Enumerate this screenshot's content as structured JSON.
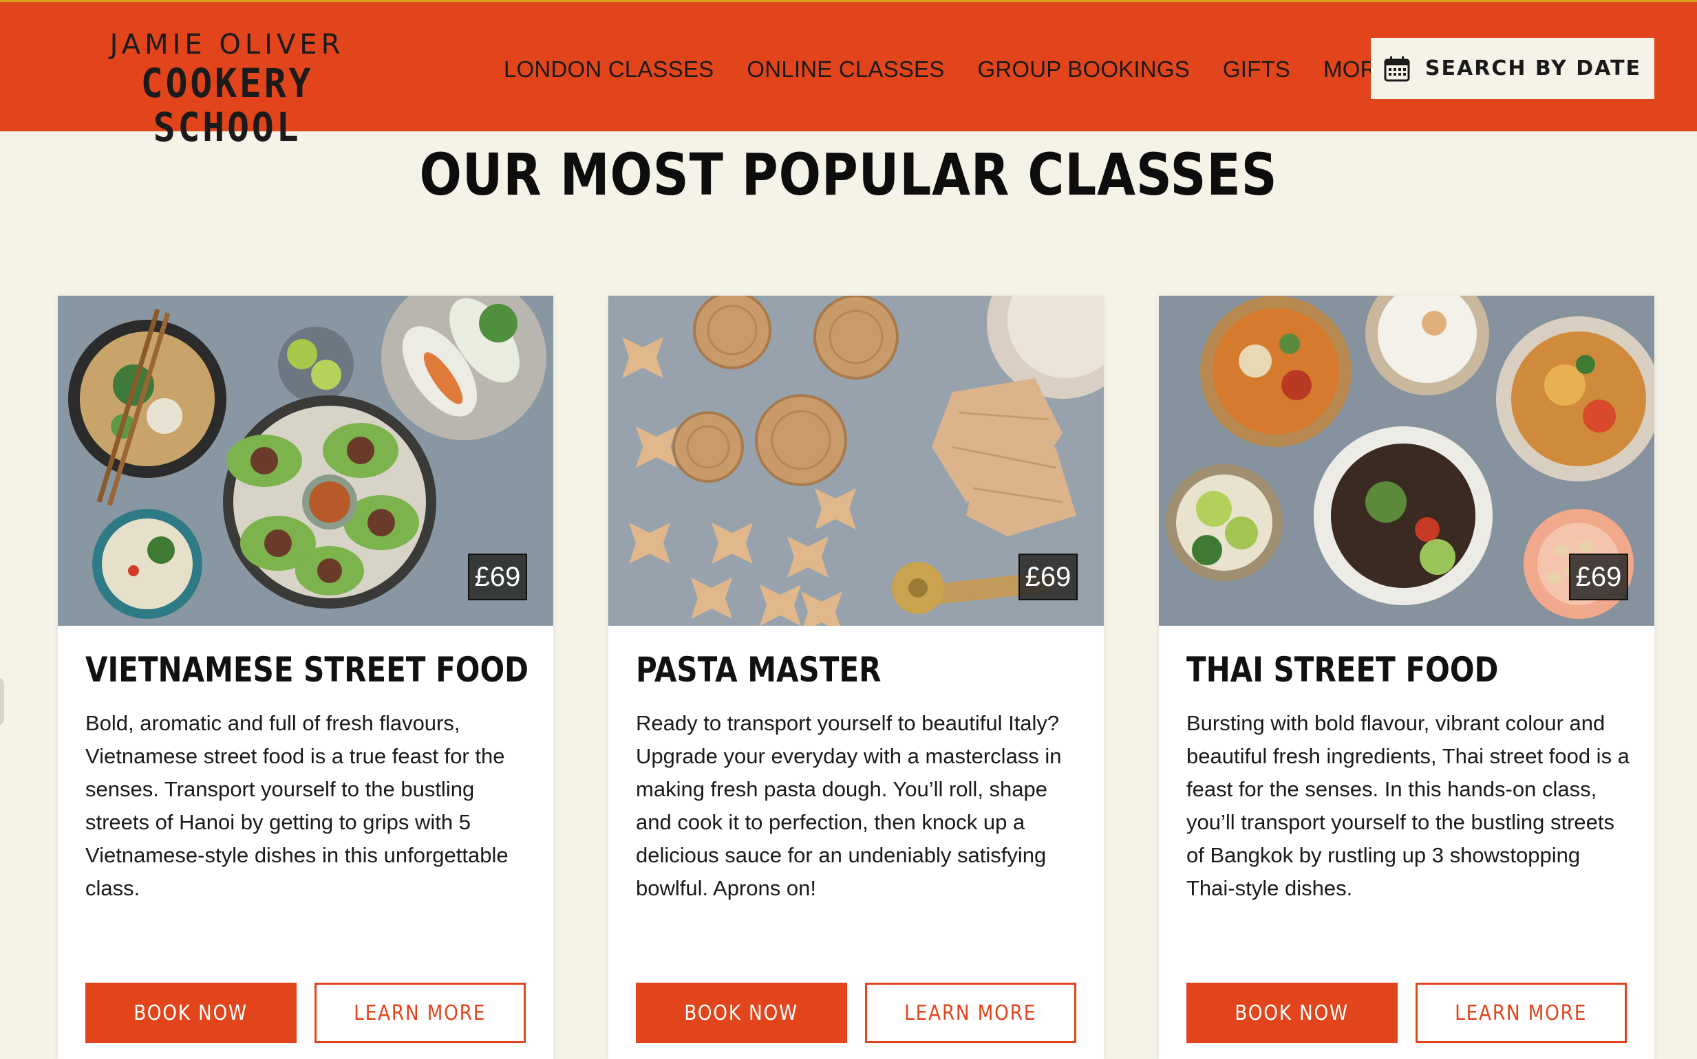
{
  "brand": {
    "line1": "JAMIE OLIVER",
    "line2": "COOKERY SCHOOL"
  },
  "nav": {
    "items": [
      "LONDON CLASSES",
      "ONLINE CLASSES",
      "GROUP BOOKINGS",
      "GIFTS",
      "MORE"
    ],
    "search_label": "SEARCH BY DATE"
  },
  "section": {
    "title": "OUR MOST POPULAR CLASSES"
  },
  "colors": {
    "brand_orange": "#e2441b",
    "page_bg": "#f5f2e8"
  },
  "cards": [
    {
      "title": "VIETNAMESE STREET FOOD",
      "price": "£69",
      "description": "Bold, aromatic and full of fresh flavours, Vietnamese street food is a true feast for the senses. Transport yourself to the bustling streets of Hanoi by getting to grips with 5 Vietnamese-style dishes in this unforgettable class.",
      "book_label": "BOOK NOW",
      "learn_label": "LEARN MORE"
    },
    {
      "title": "PASTA MASTER",
      "price": "£69",
      "description": "Ready to transport yourself to beautiful Italy? Upgrade your everyday with a masterclass in making fresh pasta dough. You’ll roll, shape and cook it to perfection, then knock up a delicious sauce for an undeniably satisfying bowlful. Aprons on!",
      "book_label": "BOOK NOW",
      "learn_label": "LEARN MORE"
    },
    {
      "title": "THAI STREET FOOD",
      "price": "£69",
      "description": "Bursting with bold flavour, vibrant colour and beautiful fresh ingredients, Thai street food is a feast for the senses. In this hands-on class, you’ll transport yourself to the bustling streets of Bangkok by rustling up 3 showstopping Thai-style dishes.",
      "book_label": "BOOK NOW",
      "learn_label": "LEARN MORE"
    }
  ]
}
